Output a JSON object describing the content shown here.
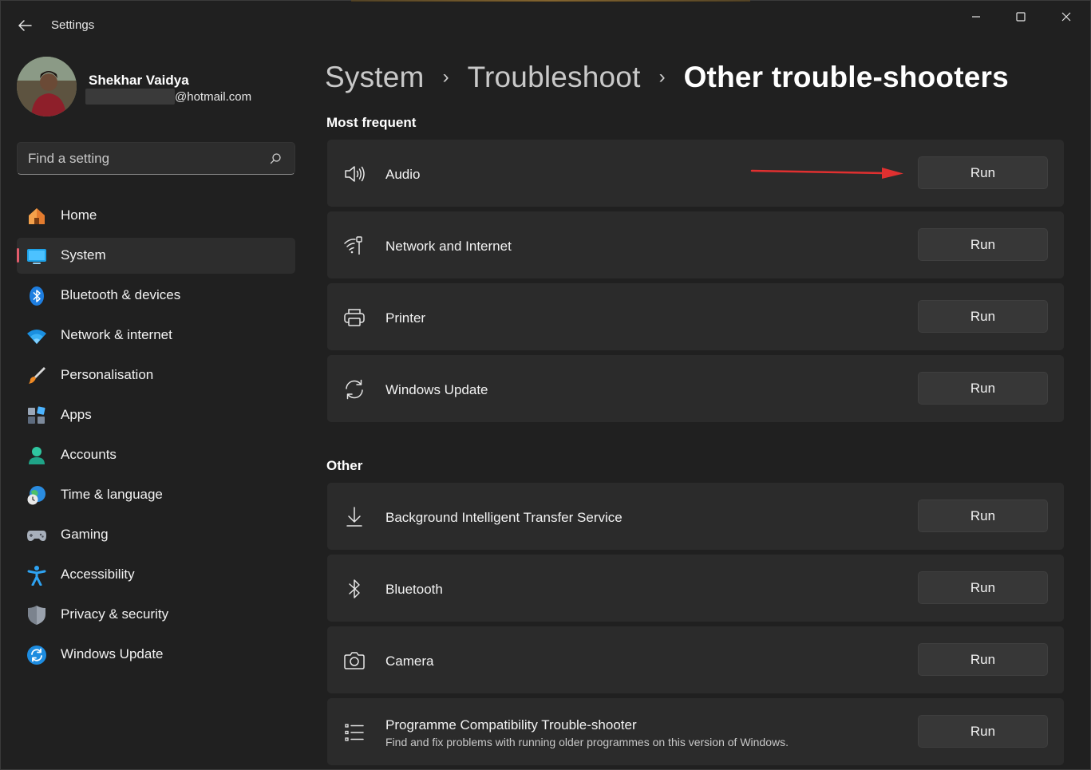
{
  "window": {
    "app_title": "Settings",
    "controls": {
      "minimize": "minimize",
      "maximize": "maximize",
      "close": "close"
    }
  },
  "profile": {
    "name": "Shekhar Vaidya",
    "email_suffix": "@hotmail.com"
  },
  "search": {
    "placeholder": "Find a setting"
  },
  "sidebar": {
    "items": [
      {
        "label": "Home",
        "icon": "home-icon"
      },
      {
        "label": "System",
        "icon": "system-icon",
        "active": true
      },
      {
        "label": "Bluetooth & devices",
        "icon": "bluetooth-icon"
      },
      {
        "label": "Network & internet",
        "icon": "wifi-icon"
      },
      {
        "label": "Personalisation",
        "icon": "brush-icon"
      },
      {
        "label": "Apps",
        "icon": "apps-icon"
      },
      {
        "label": "Accounts",
        "icon": "accounts-icon"
      },
      {
        "label": "Time & language",
        "icon": "time-language-icon"
      },
      {
        "label": "Gaming",
        "icon": "gamepad-icon"
      },
      {
        "label": "Accessibility",
        "icon": "accessibility-icon"
      },
      {
        "label": "Privacy & security",
        "icon": "shield-icon"
      },
      {
        "label": "Windows Update",
        "icon": "windows-update-icon"
      }
    ]
  },
  "breadcrumb": {
    "items": [
      "System",
      "Troubleshoot",
      "Other trouble-shooters"
    ],
    "separator": "›"
  },
  "sections": {
    "most_frequent": {
      "title": "Most frequent",
      "items": [
        {
          "label": "Audio",
          "icon": "speaker-icon",
          "button": "Run"
        },
        {
          "label": "Network and Internet",
          "icon": "network-icon",
          "button": "Run"
        },
        {
          "label": "Printer",
          "icon": "printer-icon",
          "button": "Run"
        },
        {
          "label": "Windows Update",
          "icon": "sync-icon",
          "button": "Run"
        }
      ]
    },
    "other": {
      "title": "Other",
      "items": [
        {
          "label": "Background Intelligent Transfer Service",
          "icon": "download-icon",
          "button": "Run"
        },
        {
          "label": "Bluetooth",
          "icon": "bluetooth-outline-icon",
          "button": "Run"
        },
        {
          "label": "Camera",
          "icon": "camera-icon",
          "button": "Run"
        },
        {
          "label": "Programme Compatibility Trouble-shooter",
          "sublabel": "Find and fix problems with running older programmes on this version of Windows.",
          "icon": "list-icon",
          "button": "Run"
        }
      ]
    }
  },
  "colors": {
    "background": "#202020",
    "card": "#2b2b2b",
    "button": "#373737",
    "active_indicator": "#e25c6b",
    "annotation_arrow": "#e03030"
  }
}
